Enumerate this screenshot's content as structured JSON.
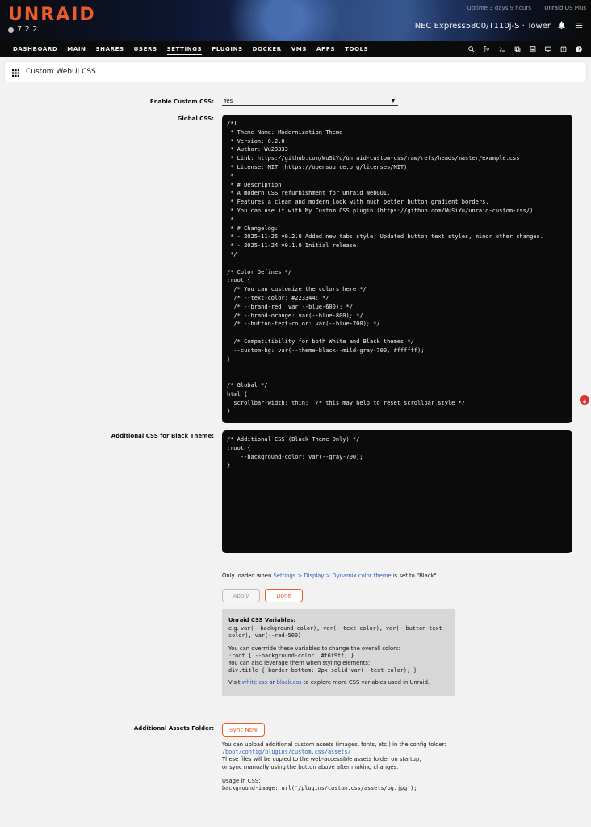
{
  "header": {
    "logo": "UNRAID",
    "version": "7.2.2",
    "uptime": "Uptime 3 days 9 hours",
    "os_label": "Unraid OS Plus",
    "server_model": "NEC Express5800/T110j-S",
    "server_separator": "·",
    "server_name": "Tower"
  },
  "nav": {
    "items": [
      {
        "label": "DASHBOARD"
      },
      {
        "label": "MAIN"
      },
      {
        "label": "SHARES"
      },
      {
        "label": "USERS"
      },
      {
        "label": "SETTINGS"
      },
      {
        "label": "PLUGINS"
      },
      {
        "label": "DOCKER"
      },
      {
        "label": "VMS"
      },
      {
        "label": "APPS"
      },
      {
        "label": "TOOLS"
      }
    ],
    "active": "SETTINGS"
  },
  "page": {
    "section_title": "Custom WebUI CSS"
  },
  "form": {
    "enable_custom_css": {
      "label": "Enable Custom CSS:",
      "value": "Yes"
    },
    "global_css": {
      "label": "Global CSS:",
      "code": "/*!\n * Theme Name: Modernization Theme\n * Version: 0.2.0\n * Author: Wu23333\n * Link: https://github.com/WuSiYu/unraid-custom-css/raw/refs/heads/master/example.css\n * License: MIT (https://opensource.org/licenses/MIT)\n *\n * # Description:\n * A modern CSS refurbishment for Unraid WebGUI.\n * Features a clean and modern look with much better button gradient borders.\n * You can use it with My Custom CSS plugin (https://github.com/WuSiYu/unraid-custom-css/)\n *\n * # Changelog:\n * - 2025-11-25 v0.2.0 Added new tabs style, Updated button text styles, minor other changes.\n * - 2025-11-24 v0.1.0 Initial release.\n */\n\n/* Color Defines */\n:root {\n  /* You can customize the colors here */\n  /* --text-color: #223344; */\n  /* --brand-red: var(--blue-600); */\n  /* --brand-orange: var(--blue-800); */\n  /* --button-text-color: var(--blue-700); */\n\n  /* Compatitibility for both White and Black themes */\n  --custom-bg: var(--theme-black--mild-gray-700, #ffffff);\n}\n\n\n/* Global */\nhtml {\n  scrollbar-width: thin;  /* this may help to reset scrollbar style */\n}"
    },
    "additional_black": {
      "label": "Additional CSS for Black Theme:",
      "code": "/* Additional CSS (Black Theme Only) */\n:root {\n    --background-color: var(--gray-700);\n}"
    },
    "note": {
      "prefix": "Only loaded when",
      "path": "Settings > Display > Dynamix color theme",
      "suffix": "is set to \"Black\"."
    },
    "buttons": {
      "apply": "Apply",
      "done": "Done"
    },
    "vars_box": {
      "title": "Unraid CSS Variables:",
      "example_prefix": "e.g.",
      "example_line_1": "var(--background-color), var(--text-color), var(--button-text-",
      "example_line_2": "color), var(--red-500)",
      "override_text": "You can overrride these variables to change the overall colors:",
      "override_code": ":root { --background-color: #f6f9ff; }",
      "leverage_text": "You can also leverage them when styling elements:",
      "leverage_code": "div.title { border-bottom: 2px solid var(--text-color); }",
      "visit_prefix": "Visit",
      "link_white": "white.css",
      "or_text": "or",
      "link_black": "black.css",
      "visit_suffix": "to explore more CSS variables used in Unraid."
    },
    "assets": {
      "label": "Additional Assets Folder:",
      "button": "Sync Now",
      "line1": "You can upload additional custom assets (images, fonts, etc.) in the config folder:",
      "path": "/boot/config/plugins/custom.css/assets/",
      "line2": "These files will be copied to the web-accessible assets folder on startup,",
      "line3": "or sync manually using the button above after making changes.",
      "usage_label": "Usage in CSS:",
      "usage_code": "background-image: url('/plugins/custom.css/assets/bg.jpg');"
    }
  },
  "icons": {
    "header": [
      "bell-icon",
      "menu-icon"
    ],
    "nav": [
      "search-icon",
      "logout-icon",
      "terminal-icon",
      "copy-icon",
      "notes-icon",
      "monitor-icon",
      "info-icon",
      "help-icon"
    ],
    "section": "grid-icon",
    "scroll": "down-arrow-icon"
  },
  "colors": {
    "brand": "#ef5a2d",
    "accent": "#f05a2a",
    "code_bg": "#0b0b0b",
    "page_bg": "#f2f2f2",
    "link": "#2e5dbb"
  }
}
